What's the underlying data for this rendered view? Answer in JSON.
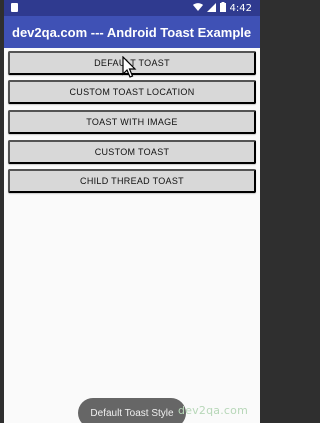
{
  "status_bar": {
    "time": "4:42",
    "wifi_icon": "wifi-icon",
    "signal_icon": "signal-icon",
    "battery_icon": "battery-icon",
    "notification_icon": "notification-icon"
  },
  "app_bar": {
    "title": "dev2qa.com --- Android Toast Example"
  },
  "buttons": [
    {
      "label": "DEFAULT TOAST"
    },
    {
      "label": "CUSTOM TOAST LOCATION"
    },
    {
      "label": "TOAST WITH IMAGE"
    },
    {
      "label": "CUSTOM TOAST"
    },
    {
      "label": "CHILD THREAD TOAST"
    }
  ],
  "toast": {
    "message": "Default Toast Style"
  },
  "watermark": {
    "text": "dev2qa.com"
  },
  "colors": {
    "status_bar": "#2f3a8f",
    "app_bar": "#3f51b5",
    "button": "#d8d8d8",
    "toast": "#666666",
    "background": "#fafafa"
  }
}
